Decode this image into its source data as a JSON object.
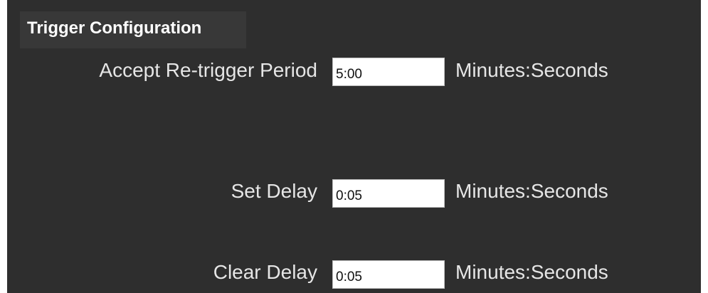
{
  "section": {
    "title": "Trigger Configuration"
  },
  "fields": [
    {
      "label": "Accept Re-trigger Period",
      "value": "5:00",
      "unit": "Minutes:Seconds"
    },
    {
      "label": "Set Delay",
      "value": "0:05",
      "unit": "Minutes:Seconds"
    },
    {
      "label": "Clear Delay",
      "value": "0:05",
      "unit": "Minutes:Seconds"
    }
  ],
  "colors": {
    "panel_background": "#2e2e2e",
    "title_bar_background": "#383838",
    "text": "#e6e6e6",
    "input_background": "#ffffff"
  }
}
